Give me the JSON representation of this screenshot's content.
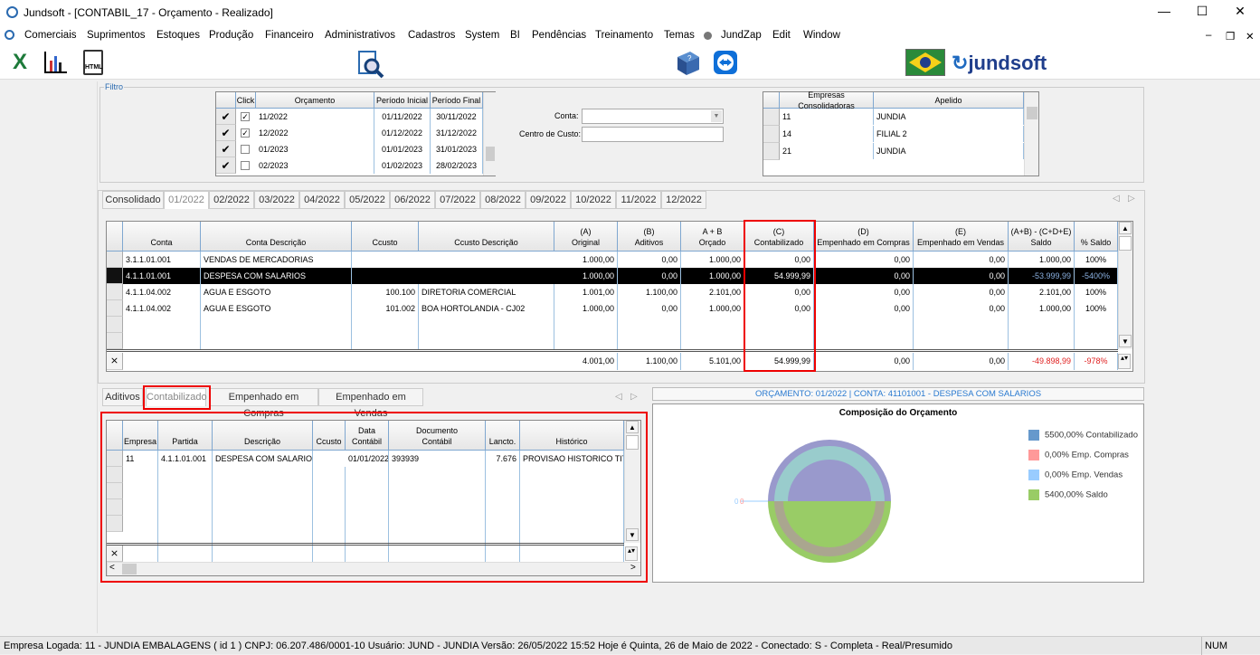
{
  "window": {
    "title": "Jundsoft - [CONTABIL_17 - Orçamento - Realizado]",
    "minimize": "—",
    "maximize": "☐",
    "close": "✕"
  },
  "menu": [
    "Comerciais",
    "Suprimentos",
    "Estoques",
    "Produção",
    "Financeiro",
    "Administrativos",
    "Cadastros",
    "System",
    "BI",
    "Pendências",
    "Treinamento",
    "Temas",
    "JundZap",
    "Edit",
    "Window"
  ],
  "mdi_controls": {
    "minimize": "–",
    "restore": "❐",
    "close": "✕"
  },
  "toolbar": {
    "excel": "X",
    "chart": "📊",
    "html": "HTML",
    "brand": "jundsoft"
  },
  "filtro": {
    "label": "Filtro",
    "budget_grid": {
      "headers": [
        "Click",
        "Orçamento",
        "Período Inicial",
        "Período Final"
      ],
      "rows": [
        {
          "checked": true,
          "orcamento": "11/2022",
          "inicio": "01/11/2022",
          "fim": "30/11/2022"
        },
        {
          "checked": true,
          "orcamento": "12/2022",
          "inicio": "01/12/2022",
          "fim": "31/12/2022"
        },
        {
          "checked": false,
          "orcamento": "01/2023",
          "inicio": "01/01/2023",
          "fim": "31/01/2023"
        },
        {
          "checked": false,
          "orcamento": "02/2023",
          "inicio": "01/02/2023",
          "fim": "28/02/2023"
        }
      ]
    },
    "conta_label": "Conta:",
    "conta_value": "",
    "centro_label": "Centro de Custo:",
    "centro_value": "",
    "empresas_grid": {
      "headers": [
        "Empresas Consolidadoras",
        "Apelido"
      ],
      "rows": [
        {
          "codigo": "11",
          "apelido": "JUNDIA"
        },
        {
          "codigo": "14",
          "apelido": "FILIAL 2"
        },
        {
          "codigo": "21",
          "apelido": "JUNDIA"
        }
      ]
    }
  },
  "period_tabs": [
    "Consolidado",
    "01/2022",
    "02/2022",
    "03/2022",
    "04/2022",
    "05/2022",
    "06/2022",
    "07/2022",
    "08/2022",
    "09/2022",
    "10/2022",
    "11/2022",
    "12/2022"
  ],
  "active_period_tab": "01/2022",
  "main_grid": {
    "headers": [
      [
        "",
        "Conta"
      ],
      [
        "",
        "Conta Descrição"
      ],
      [
        "",
        "Ccusto"
      ],
      [
        "",
        "Ccusto Descrição"
      ],
      [
        "(A)",
        "Original"
      ],
      [
        "(B)",
        "Aditivos"
      ],
      [
        "A + B",
        "Orçado"
      ],
      [
        "(C)",
        "Contabilizado"
      ],
      [
        "(D)",
        "Empenhado em Compras"
      ],
      [
        "(E)",
        "Empenhado em Vendas"
      ],
      [
        "(A+B) - (C+D+E)",
        "Saldo"
      ],
      [
        "",
        "% Saldo"
      ]
    ],
    "rows": [
      [
        "3.1.1.01.001",
        "VENDAS DE MERCADORIAS",
        "",
        "",
        "1.000,00",
        "0,00",
        "1.000,00",
        "0,00",
        "0,00",
        "0,00",
        "1.000,00",
        "100%"
      ],
      [
        "4.1.1.01.001",
        "DESPESA COM SALARIOS",
        "",
        "",
        "1.000,00",
        "0,00",
        "1.000,00",
        "54.999,99",
        "0,00",
        "0,00",
        "-53.999,99",
        "-5400%"
      ],
      [
        "4.1.1.04.002",
        "AGUA E ESGOTO",
        "100.100",
        "DIRETORIA COMERCIAL",
        "1.001,00",
        "1.100,00",
        "2.101,00",
        "0,00",
        "0,00",
        "0,00",
        "2.101,00",
        "100%"
      ],
      [
        "4.1.1.04.002",
        "AGUA E ESGOTO",
        "101.002",
        "BOA HORTOLANDIA - CJ02",
        "1.000,00",
        "0,00",
        "1.000,00",
        "0,00",
        "0,00",
        "0,00",
        "1.000,00",
        "100%"
      ]
    ],
    "selected_row": 1,
    "totals": [
      "",
      "",
      "",
      "",
      "4.001,00",
      "1.100,00",
      "5.101,00",
      "54.999,99",
      "0,00",
      "0,00",
      "-49.898,99",
      "-978%"
    ]
  },
  "detail_tabs": [
    "Aditivos",
    "Contabilizado",
    "Empenhado em Compras",
    "Empenhado em Vendas"
  ],
  "active_detail_tab": "Contabilizado",
  "detail_grid": {
    "headers": [
      [
        "",
        "Empresa"
      ],
      [
        "",
        "Partida"
      ],
      [
        "",
        "Descrição"
      ],
      [
        "",
        "Ccusto"
      ],
      [
        "Data",
        "Contábil"
      ],
      [
        "Documento",
        "Contábil"
      ],
      [
        "",
        "Lancto."
      ],
      [
        "",
        "Histórico"
      ]
    ],
    "rows": [
      [
        "11",
        "4.1.1.01.001",
        "DESPESA COM SALARIOS",
        "",
        "01/01/2022",
        "393939",
        "7.676",
        "PROVISAO HISTORICO TITU"
      ]
    ]
  },
  "chart_header": "ORÇAMENTO: 01/2022 | CONTA: 41101001 - DESPESA COM SALARIOS",
  "chart_data": {
    "type": "pie",
    "title": "Composição do Orçamento",
    "categories": [
      "Contabilizado",
      "Emp. Compras",
      "Emp. Vendas",
      "Saldo"
    ],
    "values": [
      5500.0,
      0.0,
      0.0,
      5400.0
    ],
    "legend": [
      "5500,00% Contabilizado",
      "0,00% Emp. Compras",
      "0,00% Emp. Vendas",
      "5400,00% Saldo"
    ],
    "colors": [
      "#6699cc",
      "#ff9999",
      "#99ccff",
      "#99cc66"
    ],
    "zero_labels": [
      "0",
      "0"
    ],
    "legend_position": "right"
  },
  "status": {
    "text": "Empresa Logada: 11 - JUNDIA EMBALAGENS ( id 1 ) CNPJ: 06.207.486/0001-10    Usuário: JUND - JUNDIA    Versão: 26/05/2022 15:52    Hoje é Quinta, 26 de Maio de 2022 - Conectado: S - Completa - Real/Presumido",
    "num": "NUM"
  }
}
